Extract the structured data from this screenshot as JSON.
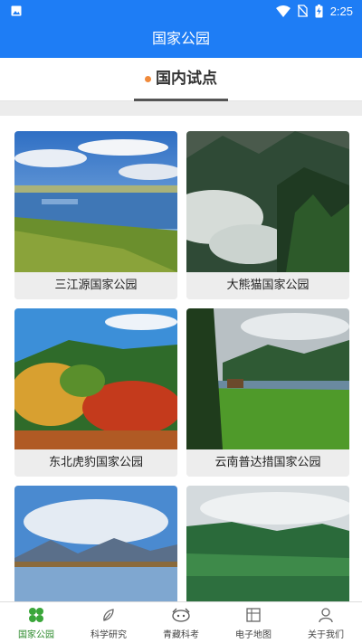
{
  "status_bar": {
    "time": "2:25"
  },
  "app_bar": {
    "title": "国家公园"
  },
  "tabs": [
    {
      "label": "国内试点",
      "active": true
    }
  ],
  "parks": [
    {
      "name": "三江源国家公园"
    },
    {
      "name": "大熊猫国家公园"
    },
    {
      "name": "东北虎豹国家公园"
    },
    {
      "name": "云南普达措国家公园"
    },
    {
      "name": ""
    },
    {
      "name": ""
    }
  ],
  "bottom_nav": [
    {
      "label": "国家公园",
      "icon": "park-icon",
      "active": true
    },
    {
      "label": "科学研究",
      "icon": "research-icon",
      "active": false
    },
    {
      "label": "青藏科考",
      "icon": "expedition-icon",
      "active": false
    },
    {
      "label": "电子地图",
      "icon": "map-icon",
      "active": false
    },
    {
      "label": "关于我们",
      "icon": "user-icon",
      "active": false
    }
  ],
  "colors": {
    "primary": "#1e7df5",
    "tab_dot": "#f08a3b",
    "nav_active": "#2e8b2e"
  }
}
